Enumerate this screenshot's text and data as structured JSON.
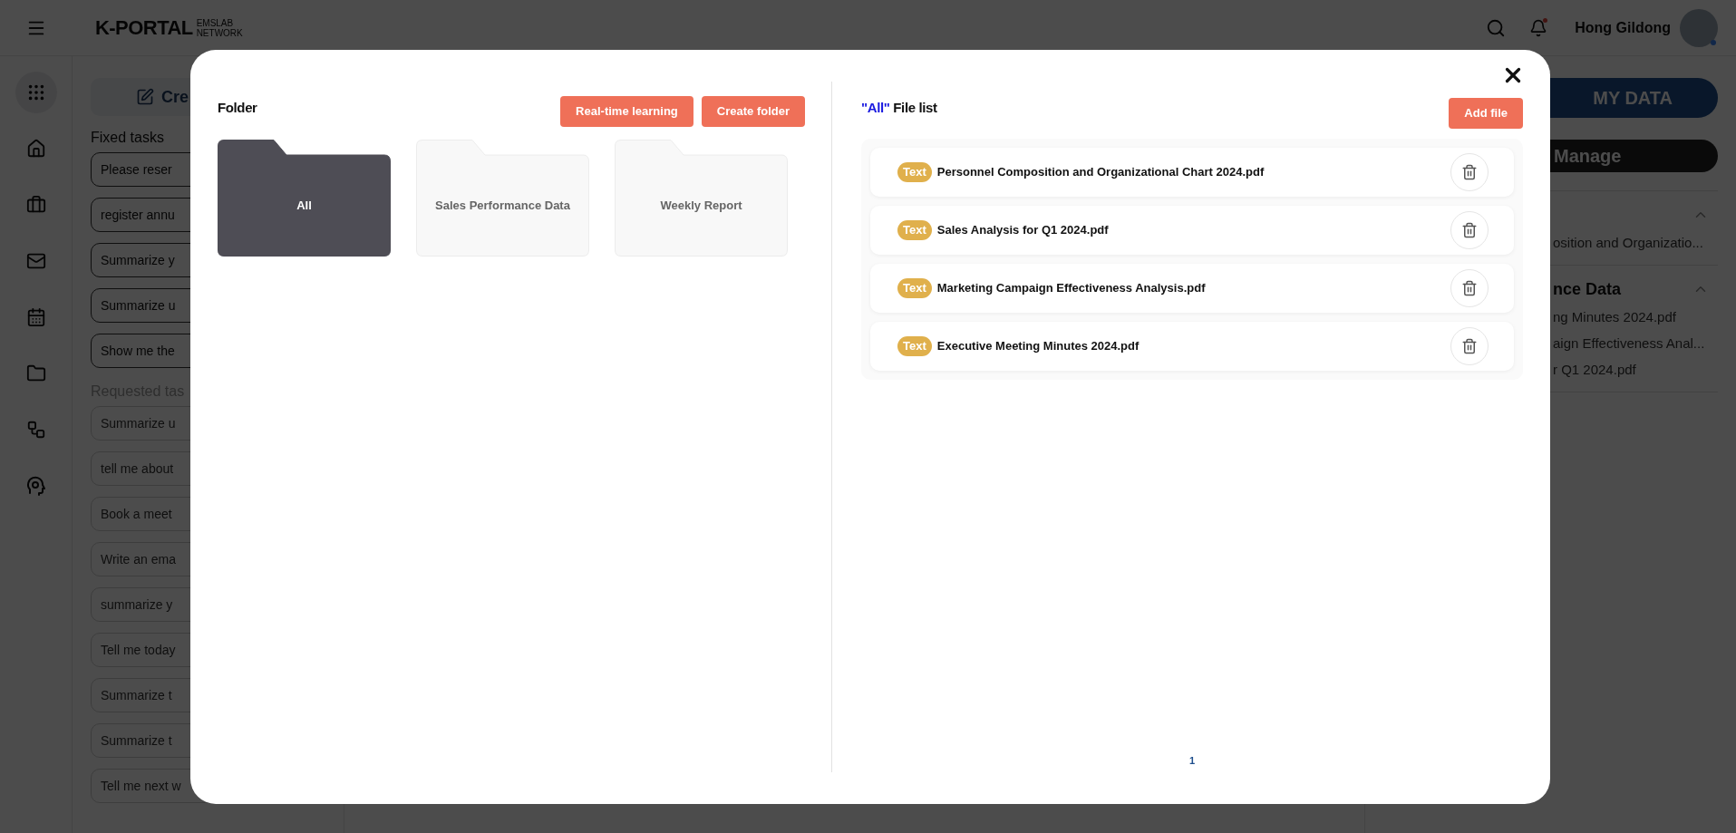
{
  "header": {
    "logo": "K-PORTAL",
    "logo_sub": [
      "EMSLAB",
      "NETWORK"
    ],
    "user_name": "Hong Gildong"
  },
  "nav_rail": [
    {
      "selected": true
    },
    {
      "selected": false
    },
    {
      "selected": false
    },
    {
      "selected": false
    },
    {
      "selected": false
    },
    {
      "selected": false
    },
    {
      "selected": false
    },
    {
      "selected": false
    }
  ],
  "left_panel": {
    "create_button": "Cre",
    "fixed_title": "Fixed tasks",
    "fixed_tasks": [
      "Please reser",
      "register annu",
      "Summarize y",
      "Summarize u",
      "Show me the"
    ],
    "requested_title": "Requested tas",
    "requested_tasks": [
      "Summarize u",
      "tell me about",
      "Book a meet",
      "Write an ema",
      "summarize y",
      "Tell me today",
      "Summarize t",
      "Summarize t",
      "Tell me next w"
    ]
  },
  "right_panel": {
    "tabs": [
      {
        "label": "MY DATA",
        "selected": true
      }
    ],
    "manage_button": "Manage",
    "groups": [
      {
        "expanded": true,
        "files": [
          "osition and Organizatio..."
        ]
      },
      {
        "title": "nce Data",
        "expanded": true,
        "files": [
          "ng Minutes 2024.pdf",
          "aign Effectiveness Anal...",
          "r Q1 2024.pdf"
        ]
      }
    ]
  },
  "modal": {
    "folder_title": "Folder",
    "buttons": [
      "Real-time learning",
      "Create folder"
    ],
    "folders": [
      {
        "name": "All",
        "selected": true
      },
      {
        "name": "Sales Performance Data",
        "selected": false
      },
      {
        "name": "Weekly Report",
        "selected": false
      }
    ],
    "file_list_title": {
      "folder": "\"All\"",
      "label": "File list"
    },
    "add_file_button": "Add file",
    "files": [
      {
        "tag": "Text",
        "name": "Personnel Composition and Organizational Chart 2024.pdf"
      },
      {
        "tag": "Text",
        "name": "Sales Analysis for Q1 2024.pdf"
      },
      {
        "tag": "Text",
        "name": "Marketing Campaign Effectiveness Analysis.pdf"
      },
      {
        "tag": "Text",
        "name": "Executive Meeting Minutes 2024.pdf"
      }
    ],
    "pagination": [
      {
        "label": "1",
        "selected": true
      }
    ]
  }
}
